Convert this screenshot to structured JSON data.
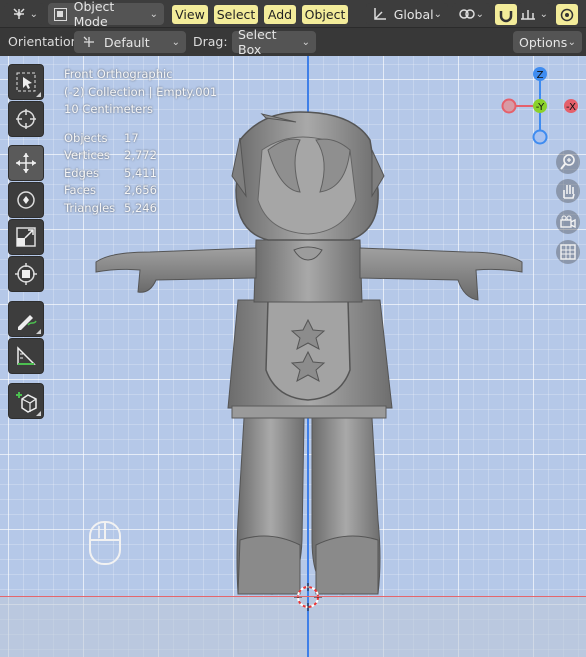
{
  "header": {
    "mode_label": "Object Mode",
    "menus": [
      "View",
      "Select",
      "Add",
      "Object"
    ],
    "transform_orientation": "Global"
  },
  "tool_header": {
    "orientation_label": "Orientation:",
    "orientation_value": "Default",
    "drag_label": "Drag:",
    "drag_value": "Select Box",
    "options_label": "Options"
  },
  "overlay": {
    "view_name": "Front Orthographic",
    "collection": "(-2) Collection | Empty.001",
    "scale": "10 Centimeters",
    "stats": [
      {
        "label": "Objects",
        "value": "17"
      },
      {
        "label": "Vertices",
        "value": "2,772"
      },
      {
        "label": "Edges",
        "value": "5,411"
      },
      {
        "label": "Faces",
        "value": "2,656"
      },
      {
        "label": "Triangles",
        "value": "5,246"
      }
    ]
  },
  "gizmo": {
    "z": "Z",
    "y": "-Y",
    "x": "-X"
  },
  "colors": {
    "accent_highlight": "#f3ec9a",
    "x_axis": "#e5606b",
    "y_axis": "#8bd22a",
    "z_axis": "#3f8cf0"
  },
  "toolbar_icons": [
    "select-box-icon",
    "cursor-icon",
    "move-icon",
    "rotate-icon",
    "scale-icon",
    "transform-icon",
    "annotate-icon",
    "measure-icon",
    "add-cube-icon"
  ]
}
